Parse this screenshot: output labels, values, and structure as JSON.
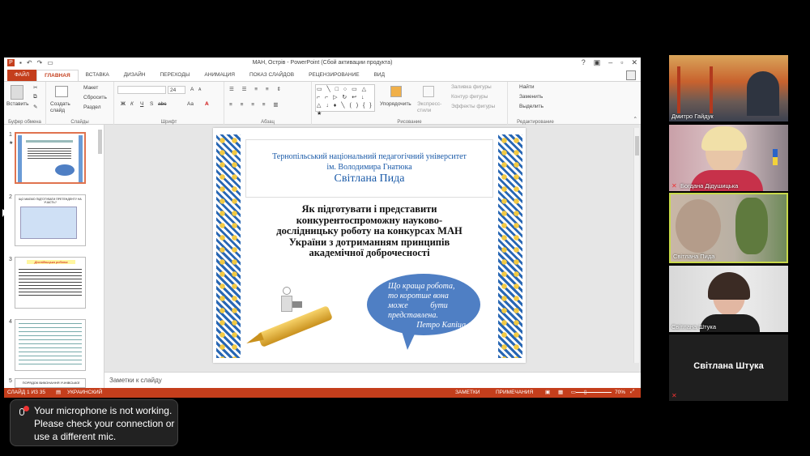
{
  "window": {
    "title": "МАН, Острів - PowerPoint (Сбой активации продукта)",
    "help": "?",
    "minimize": "–",
    "restore": "▫",
    "close": "✕"
  },
  "tabs": [
    "ФАЙЛ",
    "ГЛАВНАЯ",
    "ВСТАВКА",
    "ДИЗАЙН",
    "ПЕРЕХОДЫ",
    "АНИМАЦИЯ",
    "ПОКАЗ СЛАЙДОВ",
    "РЕЦЕНЗИРОВАНИЕ",
    "ВИД"
  ],
  "ribbon": {
    "paste": "Вставить",
    "clipboard": "Буфер обмена",
    "new_slide": "Создать слайд",
    "layout": "Макет",
    "reset": "Сбросить",
    "section": "Раздел",
    "slides": "Слайды",
    "font_size": "24",
    "font_group": "Шрифт",
    "bold": "Ж",
    "italic": "К",
    "underline": "Ч",
    "strike": "S",
    "abc": "abc",
    "grow": "A",
    "shrink": "A",
    "aa": "Aa",
    "paragraph": "Абзац",
    "arrange": "Упорядочить",
    "quick_styles": "Экспресс-стили",
    "fill": "Заливка фигуры",
    "outline": "Контур фигуры",
    "effects": "Эффекты фигуры",
    "drawing": "Рисование",
    "find": "Найти",
    "replace": "Заменить",
    "select": "Выделить",
    "editing": "Редактирование"
  },
  "thumbs": {
    "n1": "1",
    "star": "★",
    "n2": "2",
    "n3": "3",
    "n4": "4",
    "n5": "5",
    "t2_title": "ЩО МАЄМО ПІДГОТУВАТИ ПРЕТЕНДЕНТУ НА УЧАСТЬ?",
    "t3_title": "Дослідницька робота",
    "t5_title": "ПОРЯДОК ВИКОНАННЯ УЧНІВСЬКОЇ"
  },
  "slide": {
    "univ1": "Тернопільський національний педагогічний університет",
    "univ2": "ім. Володимира Гнатюка",
    "author": "Світлана Пида",
    "title_lines": [
      "Як підготувати і представити",
      "конкурентоспроможну науково-",
      "дослідницьку роботу на конкурсах МАН",
      "України з дотриманням принципів",
      "академічної доброчесності"
    ],
    "quote_lines": [
      "Що краща робота,",
      "то коротше вона",
      "може           бути",
      "представлена."
    ],
    "quote_author": "Петро Капіца"
  },
  "notes": "Заметки к слайду",
  "status": {
    "slide": "СЛАЙД 1 ИЗ 35",
    "lang": "УКРАИНСКИЙ",
    "notes": "ЗАМЕТКИ",
    "comments": "ПРИМЕЧАНИЯ",
    "zoom": "70%"
  },
  "participants": [
    {
      "name": "Дмитро Гайдук"
    },
    {
      "name": "Богдана Дідушицька",
      "muted": true
    },
    {
      "name": "Світлана Пида",
      "speaking": true
    },
    {
      "name": "Світлана Штука"
    },
    {
      "name": "Світлана Штука",
      "video_off": true
    }
  ],
  "toast": {
    "lines": [
      "Your microphone is not working.",
      "Please check your connection or",
      "use a different mic."
    ]
  },
  "colors": {
    "accent": "#c43e1c",
    "speaker_border": "#c8d94a",
    "slide_blue": "#1d5fb0",
    "bubble": "#4f7fc4"
  }
}
